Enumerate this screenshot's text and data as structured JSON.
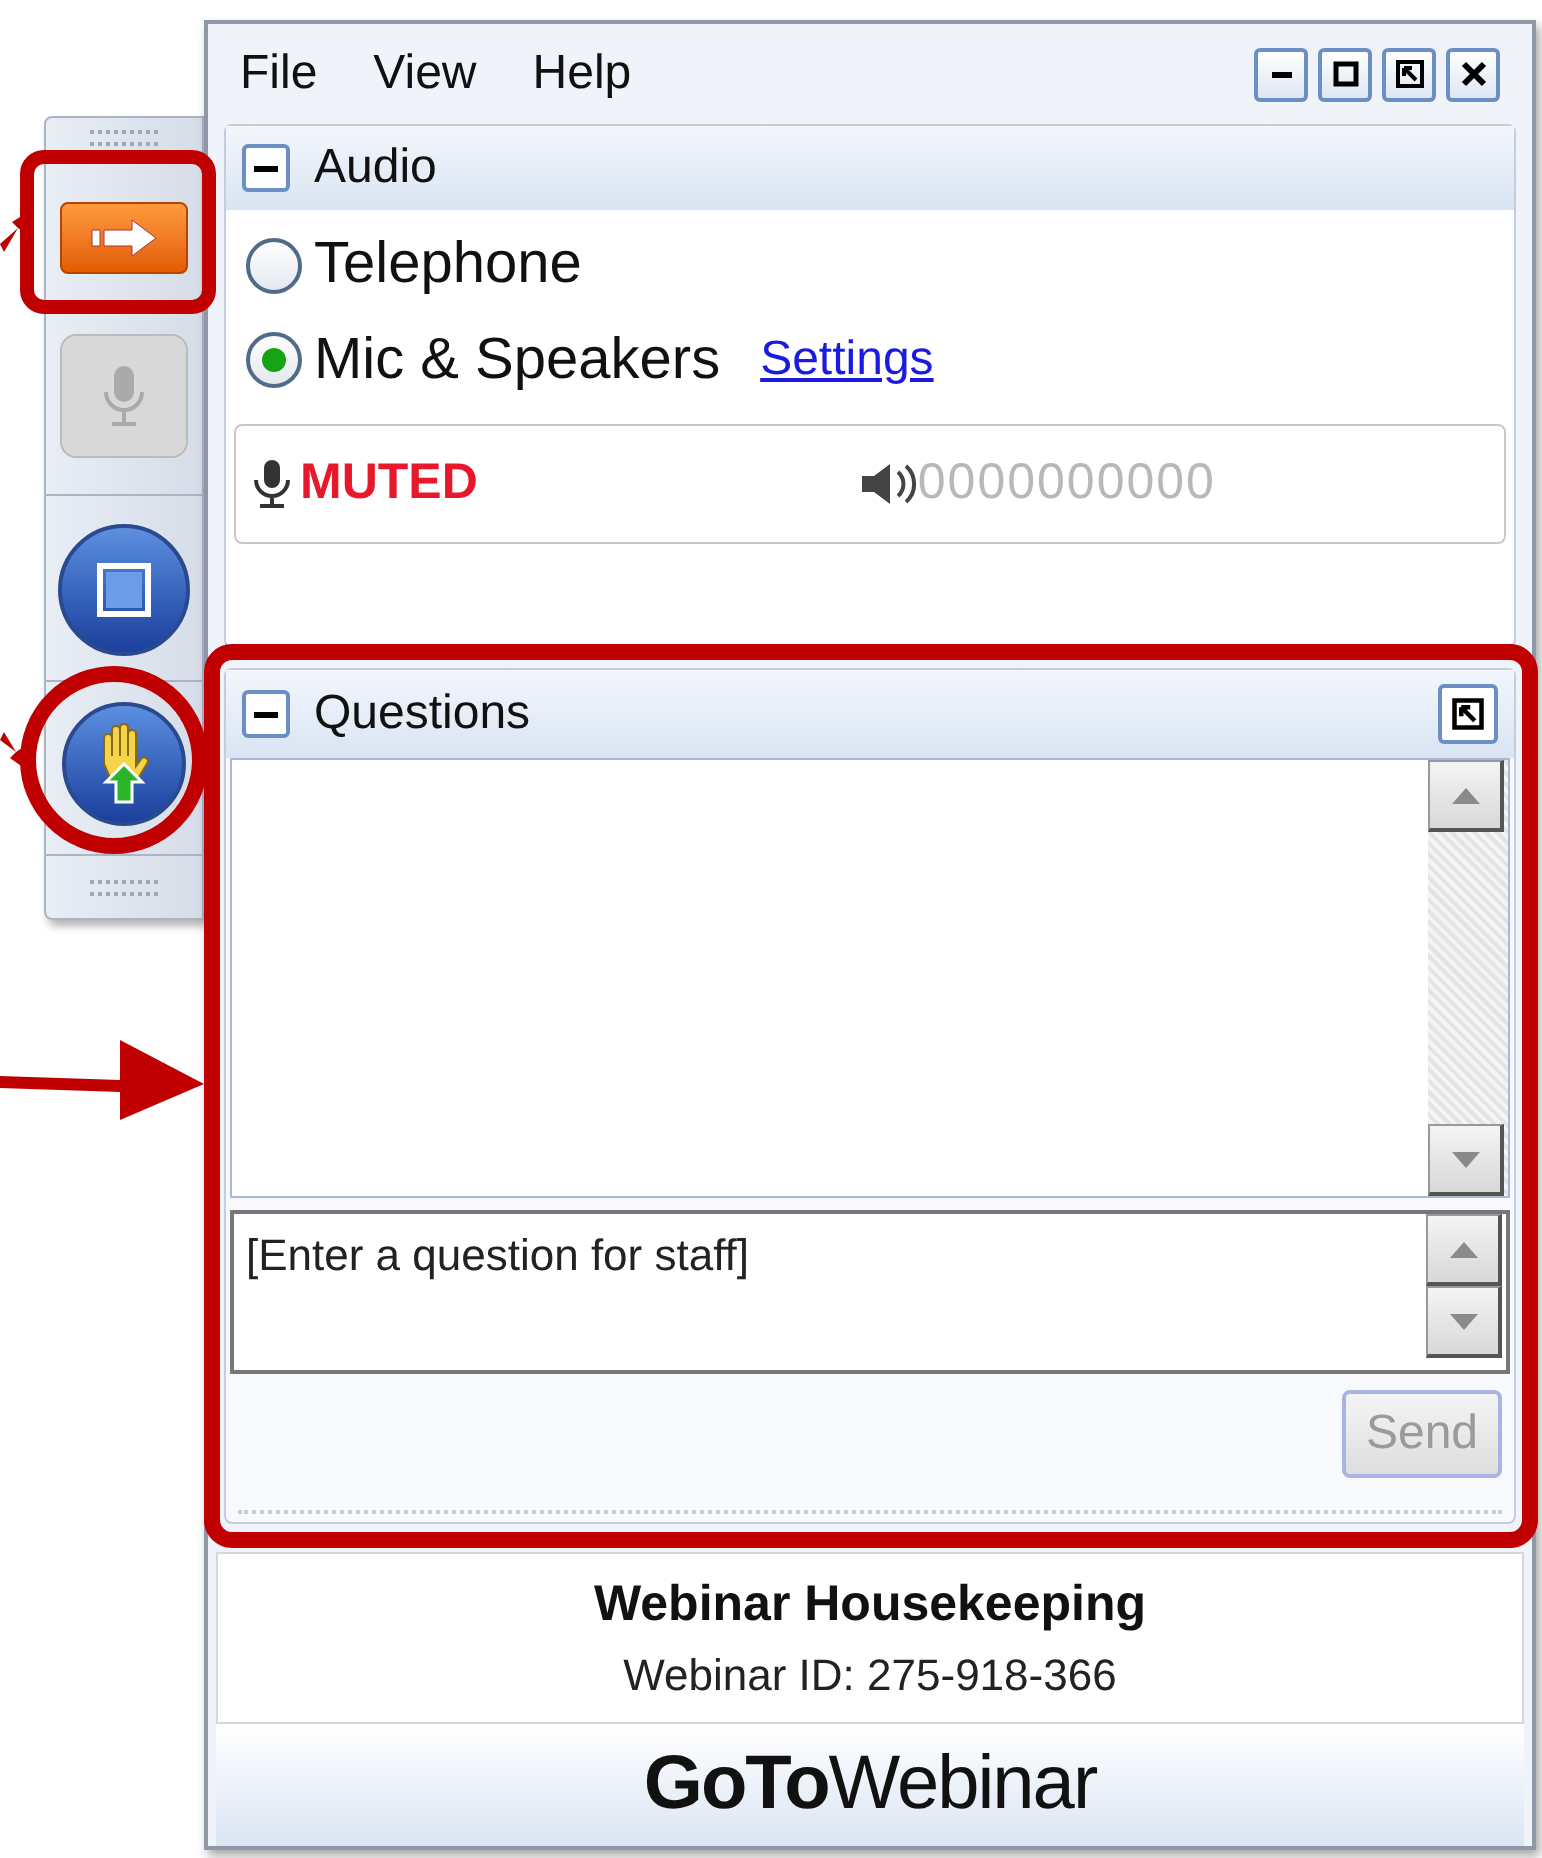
{
  "menu": [
    "File",
    "View",
    "Help"
  ],
  "audio": {
    "title": "Audio",
    "options": [
      {
        "label": "Telephone",
        "selected": false
      },
      {
        "label": "Mic & Speakers",
        "selected": true
      }
    ],
    "settings_link": "Settings",
    "mic_status": "MUTED",
    "speaker_meter": "0000000000"
  },
  "questions": {
    "title": "Questions",
    "input": {
      "placeholder": "[Enter a question for staff]"
    },
    "send": {
      "label": "Send",
      "disabled": true
    }
  },
  "footer": {
    "title": "Webinar Housekeeping",
    "webinar_id": "Webinar ID: 275-918-366",
    "logo": "**GoTo**Webinar"
  }
}
